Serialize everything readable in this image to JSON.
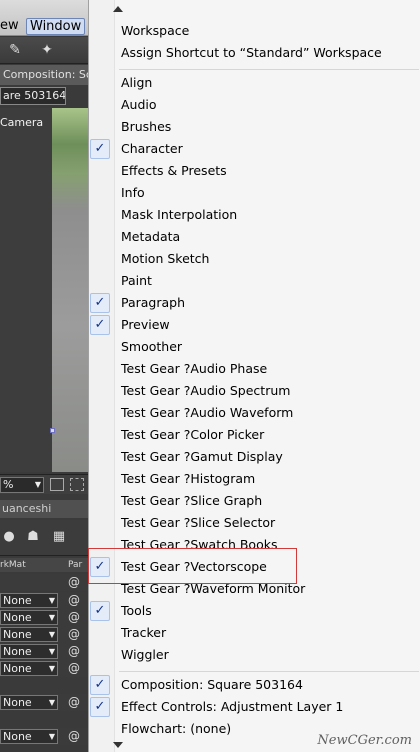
{
  "app": {
    "menubar": {
      "view_label": "ew",
      "window_label": "Window"
    },
    "composition_header": "Composition: Sc",
    "composition_tab": "are 503164",
    "viewer_label": "Camera",
    "zoom_value": "%",
    "timeline_tab": "uanceshi",
    "layer_header_trkmat": "rkMat",
    "layer_header_parent": "Par",
    "track_matte_rows": [
      "",
      "None",
      "None",
      "None",
      "None",
      "None",
      "None",
      "None"
    ]
  },
  "menu": {
    "items": [
      {
        "label": "Workspace",
        "checked": false
      },
      {
        "label": "Assign Shortcut to  “Standard”  Workspace",
        "checked": false
      },
      {
        "label": "Align",
        "checked": false
      },
      {
        "label": "Audio",
        "checked": false
      },
      {
        "label": "Brushes",
        "checked": false
      },
      {
        "label": "Character",
        "checked": true
      },
      {
        "label": "Effects & Presets",
        "checked": false
      },
      {
        "label": "Info",
        "checked": false
      },
      {
        "label": "Mask Interpolation",
        "checked": false
      },
      {
        "label": "Metadata",
        "checked": false
      },
      {
        "label": "Motion Sketch",
        "checked": false
      },
      {
        "label": "Paint",
        "checked": false
      },
      {
        "label": "Paragraph",
        "checked": true
      },
      {
        "label": "Preview",
        "checked": true
      },
      {
        "label": "Smoother",
        "checked": false
      },
      {
        "label": "Test Gear ?Audio Phase",
        "checked": false
      },
      {
        "label": "Test Gear ?Audio Spectrum",
        "checked": false
      },
      {
        "label": "Test Gear ?Audio Waveform",
        "checked": false
      },
      {
        "label": "Test Gear ?Color Picker",
        "checked": false
      },
      {
        "label": "Test Gear ?Gamut Display",
        "checked": false
      },
      {
        "label": "Test Gear ?Histogram",
        "checked": false
      },
      {
        "label": "Test Gear ?Slice Graph",
        "checked": false
      },
      {
        "label": "Test Gear ?Slice Selector",
        "checked": false
      },
      {
        "label": "Test Gear ?Swatch Books",
        "checked": false
      },
      {
        "label": "Test Gear ?Vectorscope",
        "checked": true
      },
      {
        "label": "Test Gear ?Waveform Monitor",
        "checked": false
      },
      {
        "label": "Tools",
        "checked": true
      },
      {
        "label": "Tracker",
        "checked": false
      },
      {
        "label": "Wiggler",
        "checked": false
      },
      {
        "label": "Composition: Square 503164",
        "checked": true
      },
      {
        "label": "Effect Controls: Adjustment Layer 1",
        "checked": true
      },
      {
        "label": "Flowchart: (none)",
        "checked": false
      }
    ],
    "check_glyph": "✓",
    "highlighted_item": "Test Gear ?Vectorscope"
  },
  "watermark": "NewCGer.com"
}
